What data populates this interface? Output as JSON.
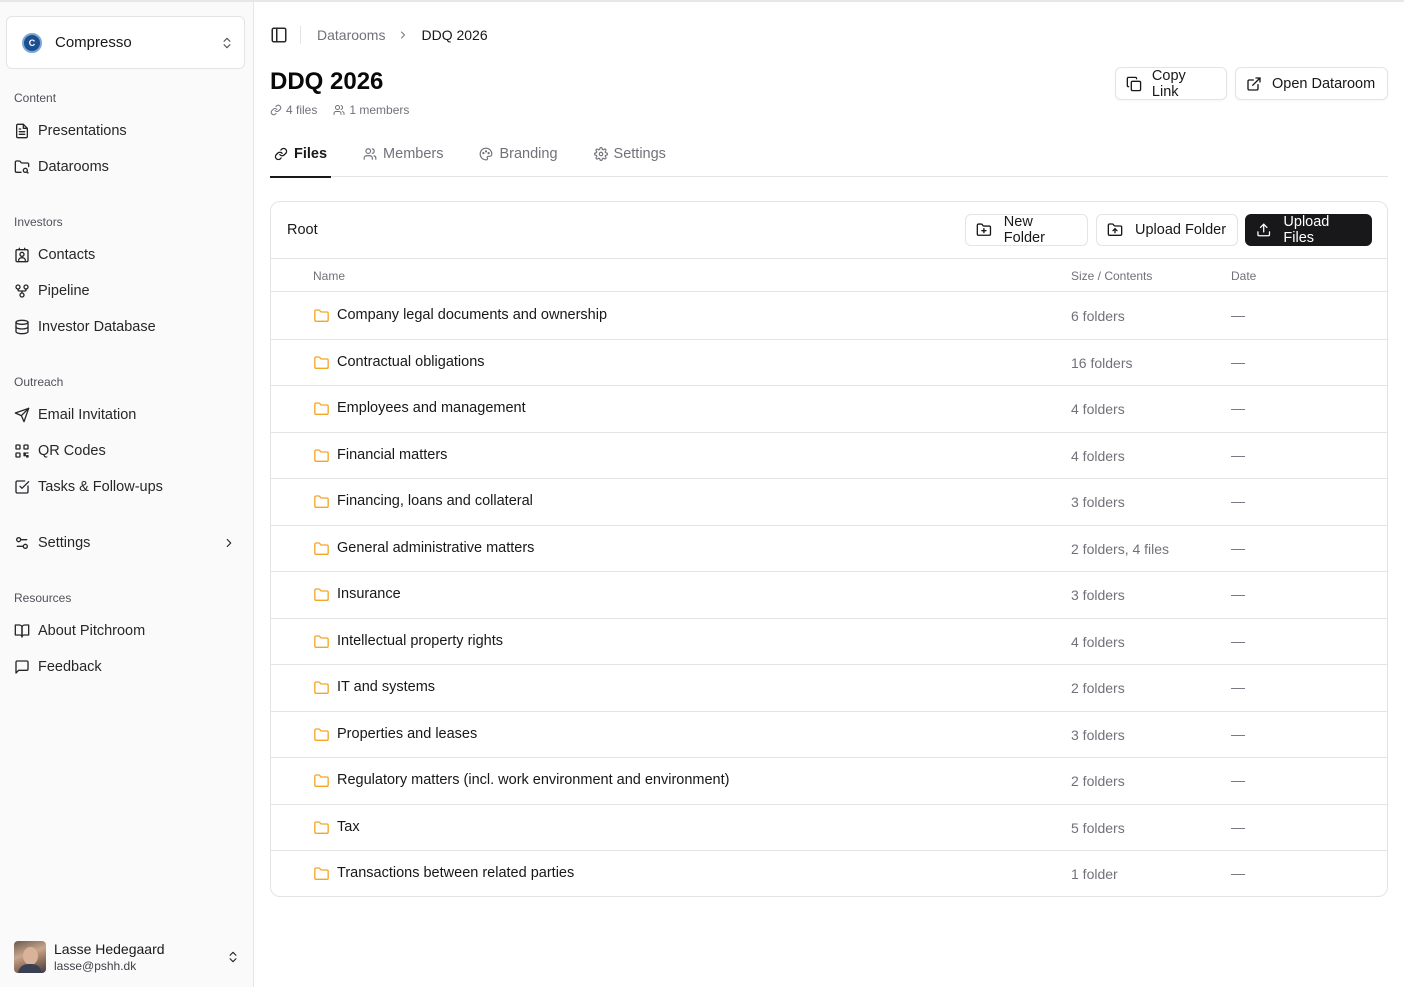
{
  "org": {
    "name": "Compresso",
    "logo_text": "C"
  },
  "sidebar": {
    "sections": [
      {
        "label": "Content",
        "items": [
          {
            "label": "Presentations",
            "icon": "file-text-icon"
          },
          {
            "label": "Datarooms",
            "icon": "folder-search-icon"
          }
        ]
      },
      {
        "label": "Investors",
        "items": [
          {
            "label": "Contacts",
            "icon": "contact-icon"
          },
          {
            "label": "Pipeline",
            "icon": "workflow-icon"
          },
          {
            "label": "Investor Database",
            "icon": "database-icon"
          }
        ]
      },
      {
        "label": "Outreach",
        "items": [
          {
            "label": "Email Invitation",
            "icon": "send-icon"
          },
          {
            "label": "QR Codes",
            "icon": "qr-code-icon"
          },
          {
            "label": "Tasks & Follow-ups",
            "icon": "check-square-icon"
          }
        ]
      },
      {
        "label": "",
        "items": [
          {
            "label": "Settings",
            "icon": "sliders-icon"
          }
        ]
      },
      {
        "label": "Resources",
        "items": [
          {
            "label": "About Pitchroom",
            "icon": "book-open-icon"
          },
          {
            "label": "Feedback",
            "icon": "message-square-icon"
          }
        ]
      }
    ]
  },
  "user": {
    "name": "Lasse Hedegaard",
    "email": "lasse@pshh.dk"
  },
  "breadcrumb": {
    "parent": "Datarooms",
    "current": "DDQ 2026"
  },
  "page": {
    "title": "DDQ 2026",
    "files_count": "4 files",
    "members_count": "1 members"
  },
  "header_buttons": {
    "copy_link": "Copy Link",
    "open_dataroom": "Open Dataroom"
  },
  "tabs": [
    {
      "label": "Files",
      "active": true
    },
    {
      "label": "Members"
    },
    {
      "label": "Branding"
    },
    {
      "label": "Settings"
    }
  ],
  "files_card": {
    "root_label": "Root",
    "new_folder": "New Folder",
    "upload_folder": "Upload Folder",
    "upload_files": "Upload Files",
    "columns": {
      "name": "Name",
      "size": "Size / Contents",
      "date": "Date"
    },
    "rows": [
      {
        "name": "Company legal documents and ownership",
        "size": "6 folders",
        "date": "—"
      },
      {
        "name": "Contractual obligations",
        "size": "16 folders",
        "date": "—"
      },
      {
        "name": "Employees and management",
        "size": "4 folders",
        "date": "—"
      },
      {
        "name": "Financial matters",
        "size": "4 folders",
        "date": "—"
      },
      {
        "name": "Financing, loans and collateral",
        "size": "3 folders",
        "date": "—"
      },
      {
        "name": "General administrative matters",
        "size": "2 folders, 4 files",
        "date": "—"
      },
      {
        "name": "Insurance",
        "size": "3 folders",
        "date": "—"
      },
      {
        "name": "Intellectual property rights",
        "size": "4 folders",
        "date": "—"
      },
      {
        "name": "IT and systems",
        "size": "2 folders",
        "date": "—"
      },
      {
        "name": "Properties and leases",
        "size": "3 folders",
        "date": "—"
      },
      {
        "name": "Regulatory matters (incl. work environment and environment)",
        "size": "2 folders",
        "date": "—"
      },
      {
        "name": "Tax",
        "size": "5 folders",
        "date": "—"
      },
      {
        "name": "Transactions between related parties",
        "size": "1 folder",
        "date": "—"
      }
    ]
  },
  "colors": {
    "folder": "#f5a524",
    "primary": "#18181b",
    "muted": "#71717a",
    "border": "#e4e4e7"
  }
}
